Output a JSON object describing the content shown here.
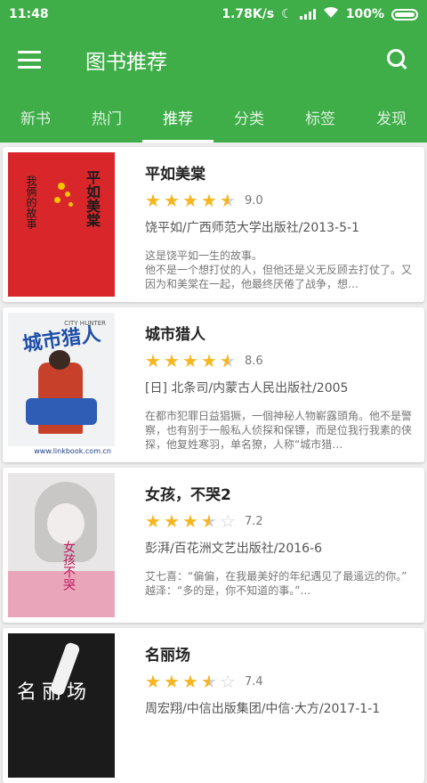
{
  "status": {
    "time": "11:48",
    "speed": "1.78K/s",
    "battery": "100%"
  },
  "toolbar": {
    "title": "图书推荐"
  },
  "tabs": [
    {
      "label": "新书"
    },
    {
      "label": "热门"
    },
    {
      "label": "推荐"
    },
    {
      "label": "分类"
    },
    {
      "label": "标签"
    },
    {
      "label": "发现"
    }
  ],
  "active_tab": "推荐",
  "colors": {
    "primary": "#3fae49",
    "star": "#f6b620"
  },
  "books": [
    {
      "title": "平如美棠",
      "rating": 4.5,
      "score": "9.0",
      "meta": "饶平如/广西师范大学出版社/2013-5-1",
      "desc": "    这是饶平如一生的故事。\n他不是一个想打仗的人，但他还是义无反顾去打仗了。又因为和美棠在一起，他最终厌倦了战争，想…",
      "cover": {
        "bg": "#d9262b",
        "text": "平如美棠 我俩的故事"
      }
    },
    {
      "title": "城市猎人",
      "rating": 4.5,
      "score": "8.6",
      "meta": "[日] 北条司/内蒙古人民出版社/2005",
      "desc": "    在都市犯罪日益猖獗，一個神秘人物嶄露頭角。他不是警察，也有别于一般私人侦探和保镖，而是位我行我素的侠探，他复姓寒羽，单名獠，人称“城市猎…",
      "cover": {
        "bg": "#f1f2f4",
        "text": "城市猎人",
        "subtitle": "CITY HUNTER",
        "footer": "www.linkbook.com.cn"
      }
    },
    {
      "title": "女孩，不哭2",
      "rating": 3.5,
      "score": "7.2",
      "meta": "彭湃/百花洲文艺出版社/2016-6",
      "desc": "    艾七喜：“偏偏，在我最美好的年纪遇见了最遥远的你。”\n越泽：“多的是，你不知道的事。”…",
      "cover": {
        "bg": "#e8e6e6",
        "text": "女孩不哭"
      }
    },
    {
      "title": "名丽场",
      "rating": 3.5,
      "score": "7.4",
      "meta": "周宏翔/中信出版集团/中信·大方/2017-1-1",
      "desc": "",
      "cover": {
        "bg": "#1b1b1b",
        "text": "名丽场"
      }
    }
  ]
}
